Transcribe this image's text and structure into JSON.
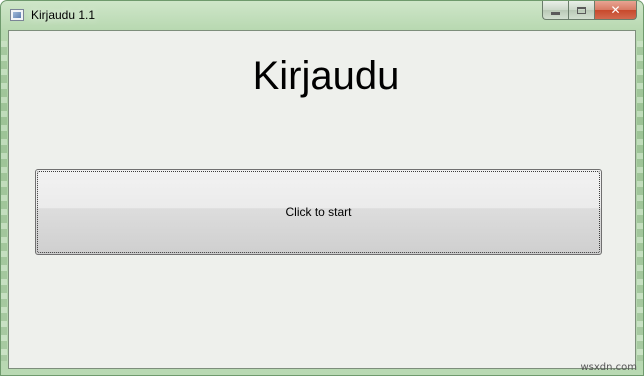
{
  "window": {
    "title": "Kirjaudu 1.1",
    "icon": "app-window-icon",
    "caption_buttons": {
      "minimize_icon": "minimize-icon",
      "maximize_icon": "maximize-icon",
      "close_icon": "close-icon",
      "close_glyph": "✕"
    }
  },
  "main": {
    "heading": "Kirjaudu",
    "start_button_label": "Click to start"
  },
  "watermark": "wsxdn.com",
  "colors": {
    "frame": "#b7d8b0",
    "client_background": "#eef0ec",
    "close_button": "#c7492c",
    "button_border": "#707070"
  }
}
